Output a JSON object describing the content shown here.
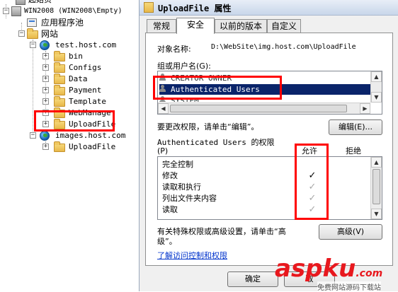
{
  "tree": {
    "items": [
      {
        "label": "起始页",
        "kind": "server"
      },
      {
        "label": "WIN2008 (WIN2008\\Empty)",
        "kind": "server"
      },
      {
        "label": "应用程序池",
        "kind": "pool"
      },
      {
        "label": "网站",
        "kind": "folder"
      },
      {
        "label": "test.host.com",
        "kind": "globe"
      },
      {
        "label": "bin",
        "kind": "folder"
      },
      {
        "label": "Configs",
        "kind": "folder"
      },
      {
        "label": "Data",
        "kind": "folder"
      },
      {
        "label": "Payment",
        "kind": "folder"
      },
      {
        "label": "Template",
        "kind": "folder"
      },
      {
        "label": "WebManage",
        "kind": "folder"
      },
      {
        "label": "UploadFile",
        "kind": "folder"
      },
      {
        "label": "images.host.com",
        "kind": "globe"
      },
      {
        "label": "UploadFile",
        "kind": "folder"
      }
    ]
  },
  "dialog": {
    "title": "UploadFile 属性",
    "tabs": [
      {
        "label": "常规"
      },
      {
        "label": "安全"
      },
      {
        "label": "以前的版本"
      },
      {
        "label": "自定义"
      }
    ],
    "object_name_label": "对象名称:",
    "object_name_value": "D:\\WebSite\\img.host.com\\UploadFile",
    "groups_label": "组或用户名(G):",
    "users": [
      {
        "name": "CREATOR OWNER"
      },
      {
        "name": "Authenticated Users"
      },
      {
        "name": "SYSTEM"
      }
    ],
    "edit_hint": "要更改权限，请单击“编辑”。",
    "edit_button": "编辑(E)...",
    "perm_title": "Authenticated Users 的权限",
    "perm_title_key": "(P)",
    "allow_header": "允许",
    "deny_header": "拒绝",
    "permissions": [
      {
        "label": "完全控制",
        "allow": "",
        "allow_state": "none"
      },
      {
        "label": "修改",
        "allow": "✓",
        "allow_state": "on"
      },
      {
        "label": "读取和执行",
        "allow": "✓",
        "allow_state": "off"
      },
      {
        "label": "列出文件夹内容",
        "allow": "✓",
        "allow_state": "off"
      },
      {
        "label": "读取",
        "allow": "✓",
        "allow_state": "off"
      }
    ],
    "advanced_hint_1": "有关特殊权限或高级设置，请单击“高",
    "advanced_hint_2": "级”。",
    "advanced_button": "高级(V)",
    "help_link": "了解访问控制和权限",
    "ok_button": "确定",
    "cancel_button": "取"
  },
  "watermark": {
    "brand": "aspku",
    "brand_suffix": ".com",
    "tagline": "免费网站源码下载站"
  },
  "colors": {
    "highlight_box": "#ff0000",
    "selection": "#0a246a",
    "link": "#0033cc",
    "watermark": "#e8181e"
  }
}
